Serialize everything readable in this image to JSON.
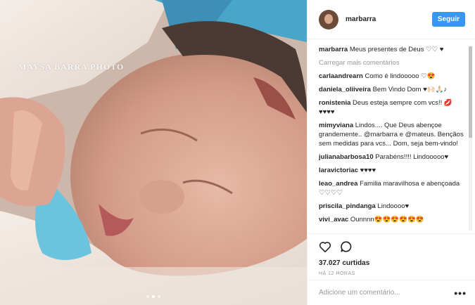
{
  "photo": {
    "watermark": "MAYSA BARRA PHOTO",
    "dots_active": 1,
    "dots_total": 3
  },
  "header": {
    "username": "marbarra",
    "follow_label": "Seguir"
  },
  "caption": {
    "user": "marbarra",
    "text": "Meus presentes de Deus ♡♡ ♥"
  },
  "load_more": "Carregar mais comentários",
  "comments": [
    {
      "user": "carlaandrearn",
      "text": "Como é lindooooo ♡😍"
    },
    {
      "user": "daniela_oliiveira",
      "text": "Bem Vindo Dom ♥🙌🏻🙏🏻♪"
    },
    {
      "user": "ronistenia",
      "text": "Deus esteja sempre com vcs!! 💋♥♥♥♥"
    },
    {
      "user": "mimyviana",
      "text": "Lindos.... Que Deus abençoe grandemente.. @marbarra e @mateus. Bençãos sem medidas para vcs... Dom, seja bem-vindo!"
    },
    {
      "user": "julianabarbosa10",
      "text": "Parabéns!!!! Lindooooo♥"
    },
    {
      "user": "laravictoriac",
      "text": "♥♥♥♥"
    },
    {
      "user": "leao_andrea",
      "text": "Familia maravilhosa e abençoada ♡♡♡♡"
    },
    {
      "user": "priscila_pindanga",
      "text": "Lindoooo♥"
    },
    {
      "user": "vivi_avac",
      "text": "Ounnnn😍😍😍😍😍😍"
    }
  ],
  "actions": {
    "like_icon": "heart-icon",
    "comment_icon": "comment-icon"
  },
  "likes": "37.027 curtidas",
  "time": "HÁ 12 HORAS",
  "add_comment": {
    "placeholder": "Adicione um comentário...",
    "options_label": "•••"
  },
  "colors": {
    "follow": "#3897f0",
    "muted": "#999999",
    "text": "#262626"
  }
}
